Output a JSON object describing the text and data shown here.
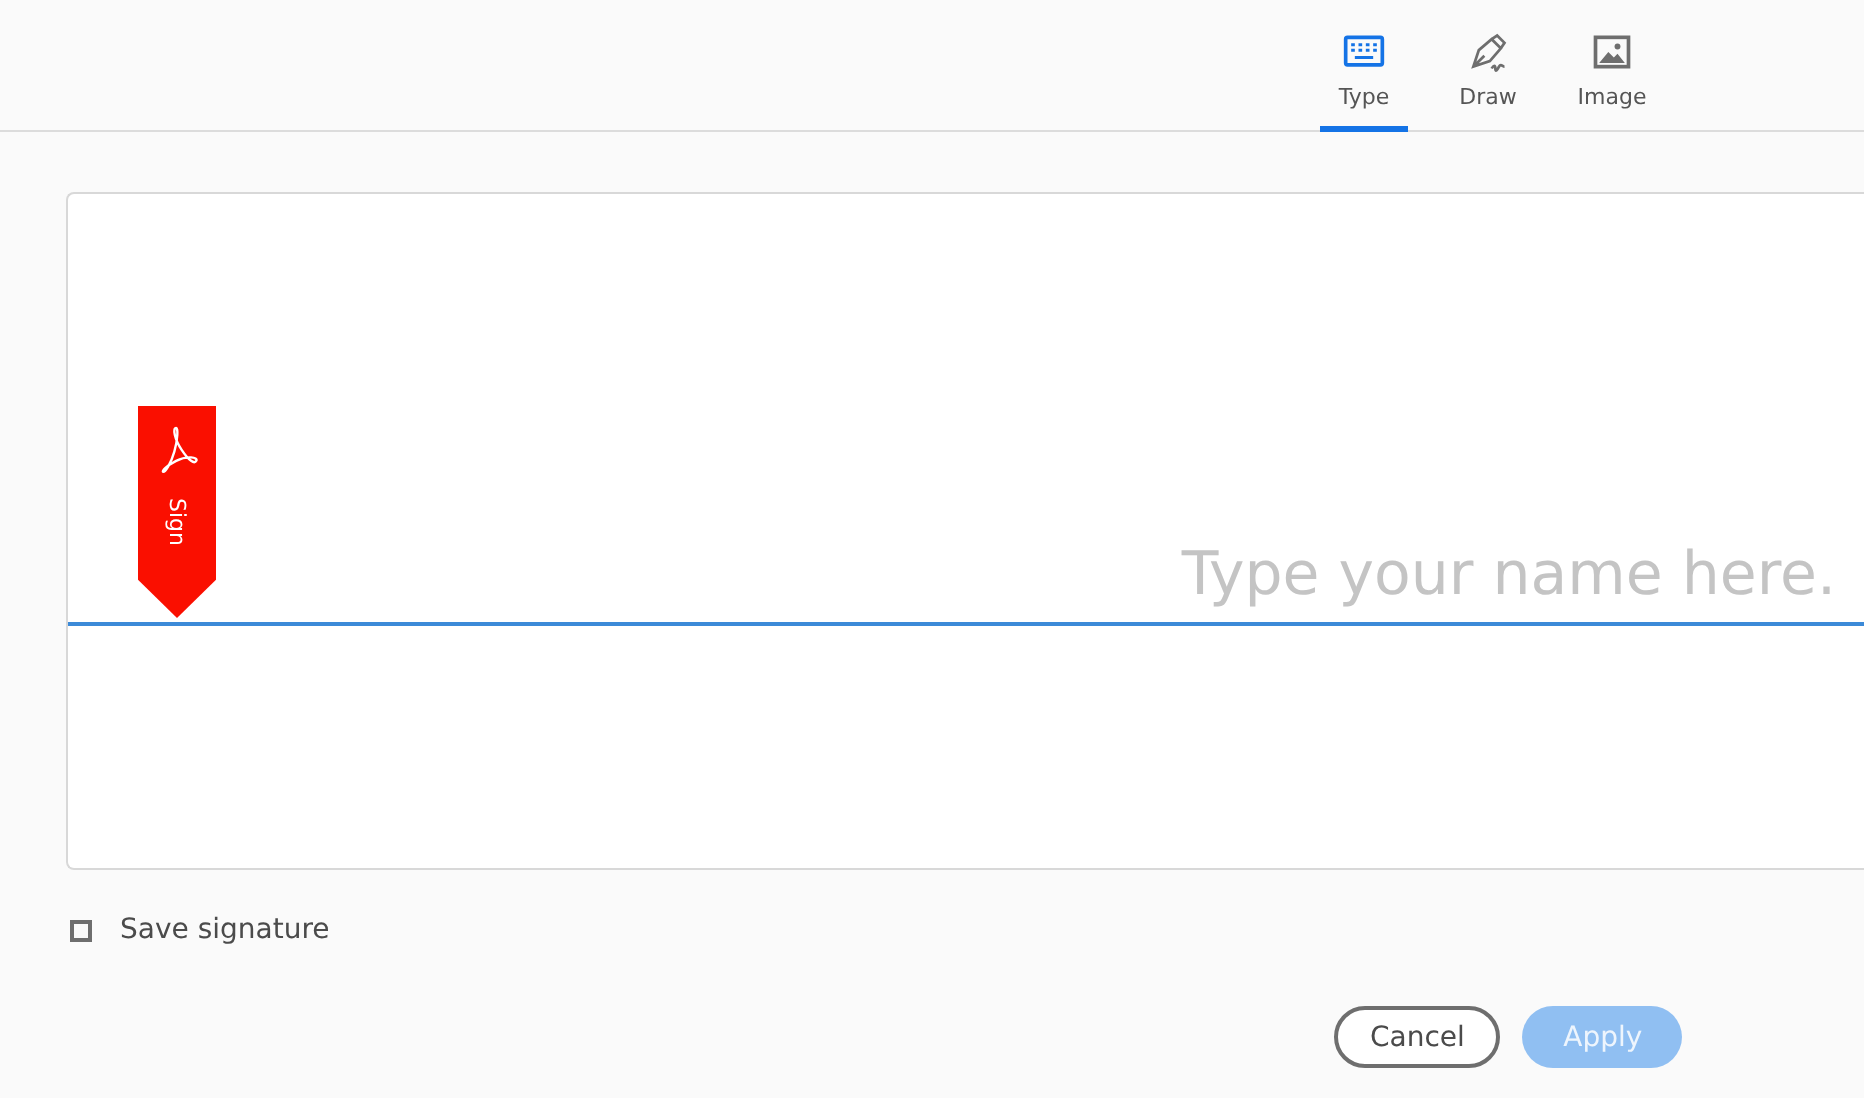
{
  "tabs": [
    {
      "label": "Type",
      "kind": "keyboard",
      "selected": true
    },
    {
      "label": "Draw",
      "kind": "pen",
      "selected": false
    },
    {
      "label": "Image",
      "kind": "image",
      "selected": false
    }
  ],
  "signature": {
    "placeholder": "Type your name here.",
    "tag_label": "Sign"
  },
  "save_signature": {
    "label": "Save signature",
    "checked": false
  },
  "buttons": [
    {
      "label": "Cancel",
      "kind": "secondary",
      "disabled": false
    },
    {
      "label": "Apply",
      "kind": "primary",
      "disabled": true
    }
  ]
}
